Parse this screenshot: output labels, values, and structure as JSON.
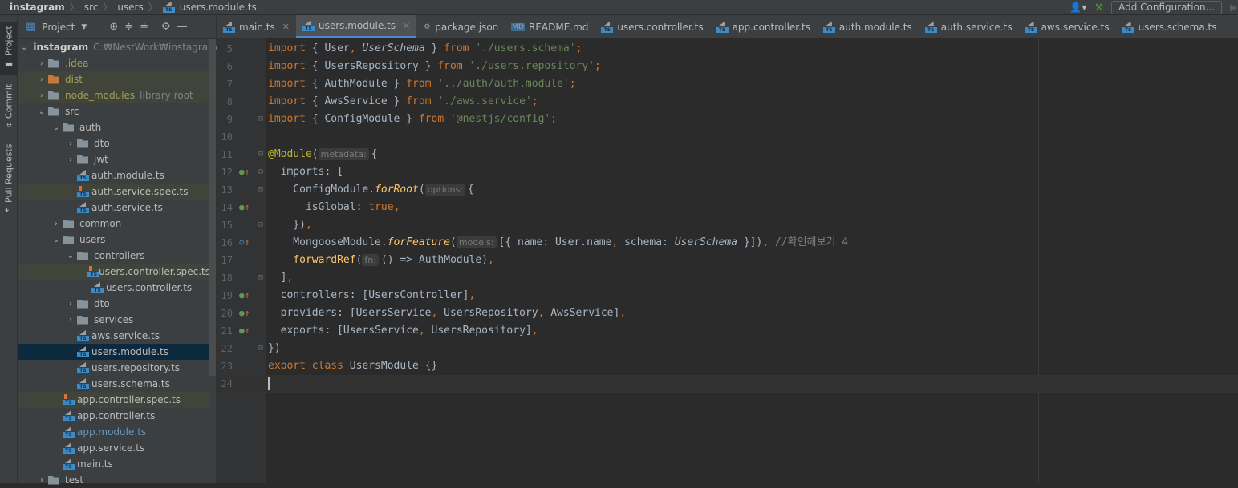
{
  "breadcrumb": {
    "items": [
      "instagram",
      "src",
      "users"
    ],
    "file": "users.module.ts"
  },
  "toolbar": {
    "add_config": "Add Configuration..."
  },
  "side_tabs": [
    "Project",
    "Commit",
    "Pull Requests"
  ],
  "project_panel": {
    "title": "Project",
    "root_path": "C:\\NestWork\\instagram"
  },
  "tree": [
    {
      "name": "instagram",
      "level": 0,
      "type": "root",
      "open": true,
      "extra": "C:₩NestWork₩instagram"
    },
    {
      "name": ".idea",
      "level": 1,
      "type": "folder",
      "style": "olive"
    },
    {
      "name": "dist",
      "level": 1,
      "type": "folder",
      "style": "orange",
      "hl": true
    },
    {
      "name": "node_modules",
      "level": 1,
      "type": "folder",
      "style": "olive",
      "hl": true,
      "extra": "library root"
    },
    {
      "name": "src",
      "level": 1,
      "type": "folder",
      "open": true
    },
    {
      "name": "auth",
      "level": 2,
      "type": "folder",
      "open": true
    },
    {
      "name": "dto",
      "level": 3,
      "type": "folder"
    },
    {
      "name": "jwt",
      "level": 3,
      "type": "folder"
    },
    {
      "name": "auth.module.ts",
      "level": 3,
      "type": "file"
    },
    {
      "name": "auth.service.spec.ts",
      "level": 3,
      "type": "spec",
      "hl": true
    },
    {
      "name": "auth.service.ts",
      "level": 3,
      "type": "file"
    },
    {
      "name": "common",
      "level": 2,
      "type": "folder"
    },
    {
      "name": "users",
      "level": 2,
      "type": "folder",
      "open": true
    },
    {
      "name": "controllers",
      "level": 3,
      "type": "folder",
      "open": true
    },
    {
      "name": "users.controller.spec.ts",
      "level": 4,
      "type": "spec",
      "hl": true
    },
    {
      "name": "users.controller.ts",
      "level": 4,
      "type": "file"
    },
    {
      "name": "dto",
      "level": 3,
      "type": "folder"
    },
    {
      "name": "services",
      "level": 3,
      "type": "folder"
    },
    {
      "name": "aws.service.ts",
      "level": 3,
      "type": "file"
    },
    {
      "name": "users.module.ts",
      "level": 3,
      "type": "file",
      "sel": true
    },
    {
      "name": "users.repository.ts",
      "level": 3,
      "type": "file"
    },
    {
      "name": "users.schema.ts",
      "level": 3,
      "type": "file"
    },
    {
      "name": "app.controller.spec.ts",
      "level": 2,
      "type": "spec",
      "hl": true
    },
    {
      "name": "app.controller.ts",
      "level": 2,
      "type": "file"
    },
    {
      "name": "app.module.ts",
      "level": 2,
      "type": "file",
      "style": "blue"
    },
    {
      "name": "app.service.ts",
      "level": 2,
      "type": "file"
    },
    {
      "name": "main.ts",
      "level": 2,
      "type": "file"
    },
    {
      "name": "test",
      "level": 1,
      "type": "folder"
    }
  ],
  "tabs": [
    {
      "label": "main.ts",
      "icon": "ts"
    },
    {
      "label": "users.module.ts",
      "icon": "ts",
      "active": true
    },
    {
      "label": "package.json",
      "icon": "json"
    },
    {
      "label": "README.md",
      "icon": "md"
    },
    {
      "label": "users.controller.ts",
      "icon": "ts"
    },
    {
      "label": "app.controller.ts",
      "icon": "ts"
    },
    {
      "label": "auth.module.ts",
      "icon": "ts"
    },
    {
      "label": "auth.service.ts",
      "icon": "ts"
    },
    {
      "label": "aws.service.ts",
      "icon": "ts"
    },
    {
      "label": "users.schema.ts",
      "icon": "ts"
    }
  ],
  "code": [
    {
      "n": 5,
      "t": [
        [
          "kw",
          "import "
        ],
        [
          "punc",
          "{ "
        ],
        [
          "id",
          "User"
        ],
        [
          "comma",
          ", "
        ],
        [
          "ital",
          "UserSchema"
        ],
        [
          "punc",
          " } "
        ],
        [
          "kw",
          "from "
        ],
        [
          "str",
          "'./users.schema'"
        ],
        [
          "comma",
          ";"
        ]
      ]
    },
    {
      "n": 6,
      "t": [
        [
          "kw",
          "import "
        ],
        [
          "punc",
          "{ "
        ],
        [
          "id",
          "UsersRepository"
        ],
        [
          "punc",
          " } "
        ],
        [
          "kw",
          "from "
        ],
        [
          "str",
          "'./users.repository'"
        ],
        [
          "comma",
          ";"
        ]
      ]
    },
    {
      "n": 7,
      "t": [
        [
          "kw",
          "import "
        ],
        [
          "punc",
          "{ "
        ],
        [
          "id",
          "AuthModule"
        ],
        [
          "punc",
          " } "
        ],
        [
          "kw",
          "from "
        ],
        [
          "str",
          "'../auth/auth.module'"
        ],
        [
          "comma",
          ";"
        ]
      ]
    },
    {
      "n": 8,
      "t": [
        [
          "kw",
          "import "
        ],
        [
          "punc",
          "{ "
        ],
        [
          "id",
          "AwsService"
        ],
        [
          "punc",
          " } "
        ],
        [
          "kw",
          "from "
        ],
        [
          "str",
          "'./aws.service'"
        ],
        [
          "comma",
          ";"
        ]
      ]
    },
    {
      "n": 9,
      "fold": true,
      "t": [
        [
          "kw",
          "import "
        ],
        [
          "punc",
          "{ "
        ],
        [
          "id",
          "ConfigModule"
        ],
        [
          "punc",
          " } "
        ],
        [
          "kw",
          "from "
        ],
        [
          "str",
          "'@nestjs/config'"
        ],
        [
          "comma",
          ";"
        ]
      ]
    },
    {
      "n": 10,
      "t": []
    },
    {
      "n": 11,
      "fold": true,
      "t": [
        [
          "ann",
          "@Module"
        ],
        [
          "punc",
          "("
        ],
        [
          "hint",
          "metadata:"
        ],
        [
          "punc",
          "{"
        ]
      ]
    },
    {
      "n": 12,
      "fold": true,
      "mark": "green",
      "t": [
        [
          "punc",
          "  "
        ],
        [
          "prop2",
          "imports"
        ],
        [
          "punc",
          ": ["
        ]
      ]
    },
    {
      "n": 13,
      "fold": true,
      "t": [
        [
          "punc",
          "    ConfigModule."
        ],
        [
          "fn",
          "forRoot"
        ],
        [
          "punc",
          "("
        ],
        [
          "hint",
          "options:"
        ],
        [
          "punc",
          "{"
        ]
      ]
    },
    {
      "n": 14,
      "mark": "green",
      "t": [
        [
          "punc",
          "      "
        ],
        [
          "prop2",
          "isGlobal"
        ],
        [
          "punc",
          ": "
        ],
        [
          "kw",
          "true"
        ],
        [
          "comma",
          ","
        ]
      ]
    },
    {
      "n": 15,
      "fold": true,
      "t": [
        [
          "punc",
          "    })"
        ],
        [
          "comma",
          ","
        ]
      ]
    },
    {
      "n": 16,
      "mark": "blue",
      "t": [
        [
          "punc",
          "    MongooseModule."
        ],
        [
          "fn",
          "forFeature"
        ],
        [
          "punc",
          "("
        ],
        [
          "hint",
          "models:"
        ],
        [
          "punc",
          "[{ "
        ],
        [
          "prop2",
          "name"
        ],
        [
          "punc",
          ": User."
        ],
        [
          "prop2",
          "name"
        ],
        [
          "comma",
          ", "
        ],
        [
          "prop2",
          "schema"
        ],
        [
          "punc",
          ": "
        ],
        [
          "ital",
          "UserSchema"
        ],
        [
          "punc",
          " }])"
        ],
        [
          "comma",
          ", "
        ],
        [
          "cmt",
          "//확인해보기 4"
        ]
      ]
    },
    {
      "n": 17,
      "t": [
        [
          "punc",
          "    "
        ],
        [
          "fn2",
          "forwardRef"
        ],
        [
          "punc",
          "("
        ],
        [
          "hint",
          "fn:"
        ],
        [
          "punc",
          "() => AuthModule)"
        ],
        [
          "comma",
          ","
        ]
      ]
    },
    {
      "n": 18,
      "fold": true,
      "t": [
        [
          "punc",
          "  ]"
        ],
        [
          "comma",
          ","
        ]
      ]
    },
    {
      "n": 19,
      "mark": "green",
      "t": [
        [
          "punc",
          "  "
        ],
        [
          "prop2",
          "controllers"
        ],
        [
          "punc",
          ": [UsersController]"
        ],
        [
          "comma",
          ","
        ]
      ]
    },
    {
      "n": 20,
      "mark": "green",
      "t": [
        [
          "punc",
          "  "
        ],
        [
          "prop2",
          "providers"
        ],
        [
          "punc",
          ": [UsersService"
        ],
        [
          "comma",
          ", "
        ],
        [
          "punc",
          "UsersRepository"
        ],
        [
          "comma",
          ", "
        ],
        [
          "punc",
          "AwsService]"
        ],
        [
          "comma",
          ","
        ]
      ]
    },
    {
      "n": 21,
      "mark": "green",
      "t": [
        [
          "punc",
          "  "
        ],
        [
          "prop2",
          "exports"
        ],
        [
          "punc",
          ": [UsersService"
        ],
        [
          "comma",
          ", "
        ],
        [
          "punc",
          "UsersRepository]"
        ],
        [
          "comma",
          ","
        ]
      ]
    },
    {
      "n": 22,
      "fold": true,
      "t": [
        [
          "punc",
          "})"
        ]
      ]
    },
    {
      "n": 23,
      "t": [
        [
          "kw",
          "export class "
        ],
        [
          "id",
          "UsersModule "
        ],
        [
          "punc",
          "{}"
        ]
      ]
    },
    {
      "n": 24,
      "cur": true,
      "t": []
    }
  ]
}
